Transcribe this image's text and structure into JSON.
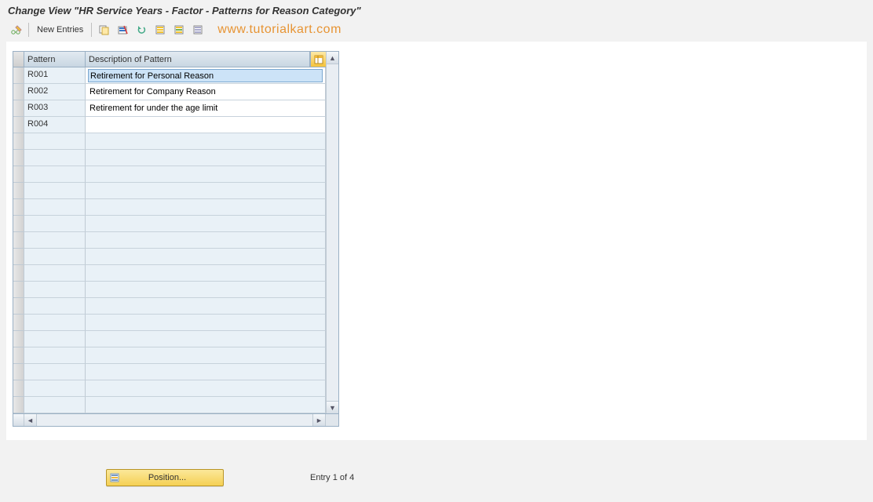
{
  "title": "Change View \"HR Service Years - Factor - Patterns for Reason Category\"",
  "watermark": "www.tutorialkart.com",
  "toolbar": {
    "new_entries_label": "New Entries",
    "icons": {
      "toggle": "toggle-change-display-icon",
      "copy": "copy-icon",
      "delete": "delete-icon",
      "undo": "undo-icon",
      "select_all": "select-all-icon",
      "select_block": "select-block-icon",
      "deselect_all": "deselect-all-icon"
    }
  },
  "table": {
    "columns": {
      "pattern": "Pattern",
      "description": "Description of Pattern"
    },
    "rows": [
      {
        "pattern": "R001",
        "description": "Retirement for Personal Reason",
        "selected": true
      },
      {
        "pattern": "R002",
        "description": "Retirement for Company Reason",
        "selected": false
      },
      {
        "pattern": "R003",
        "description": "Retirement for under the age limit",
        "selected": false
      },
      {
        "pattern": "R004",
        "description": "",
        "selected": false
      }
    ],
    "empty_row_count": 17
  },
  "footer": {
    "position_label": "Position...",
    "entry_status": "Entry 1 of 4"
  }
}
